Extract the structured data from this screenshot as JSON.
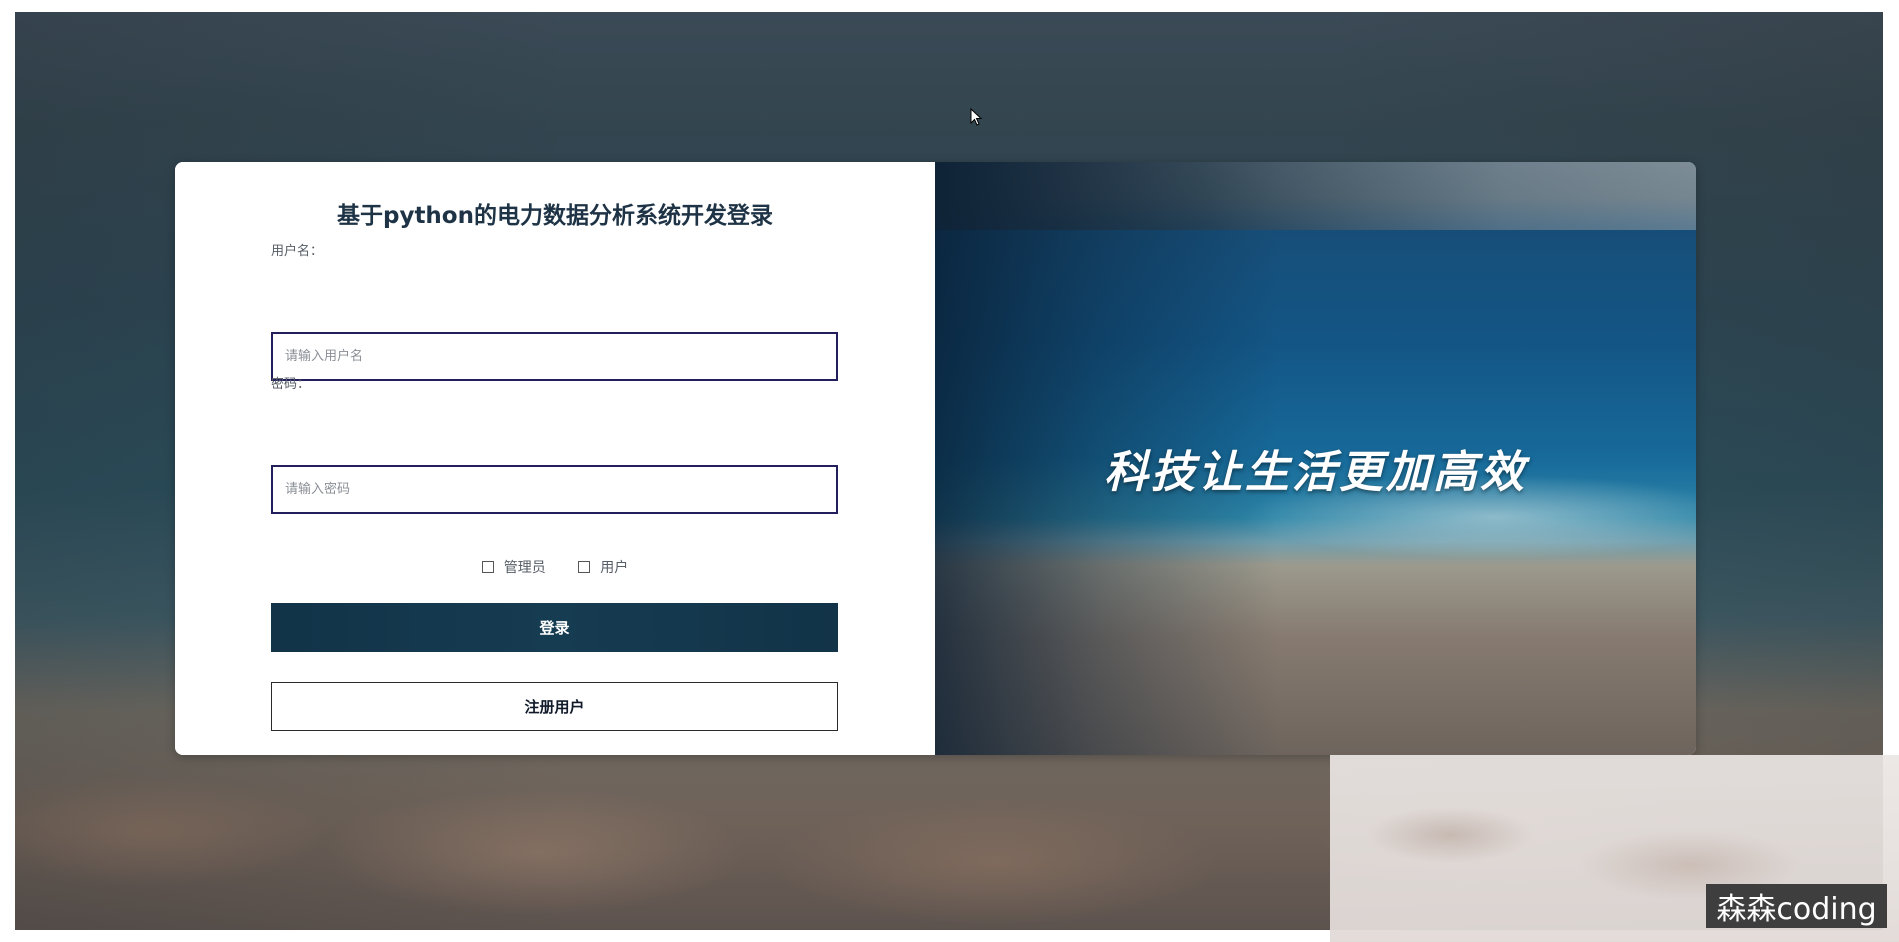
{
  "login": {
    "title": "基于python的电力数据分析系统开发登录",
    "username_label": "用户名：",
    "username_placeholder": "请输入用户名",
    "password_label": "密码：",
    "password_placeholder": "请输入密码",
    "roles": [
      "管理员",
      "用户"
    ],
    "login_button": "登录",
    "register_button": "注册用户"
  },
  "banner": {
    "slogan": "科技让生活更加高效"
  },
  "watermark": {
    "text": "森森coding"
  },
  "colors": {
    "primary": "#163c52",
    "title": "#1e3345",
    "input_border": "#231f5c"
  }
}
